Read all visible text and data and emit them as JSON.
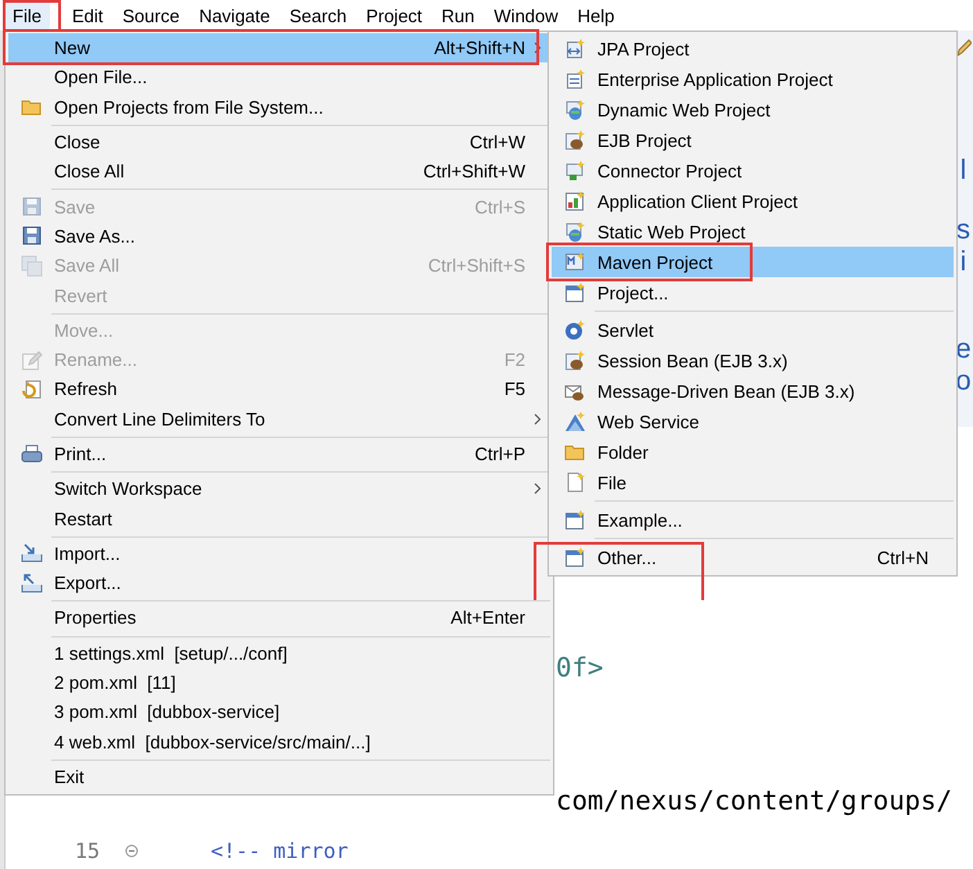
{
  "menu_bar": [
    {
      "label": "File",
      "selected": true
    },
    {
      "label": "Edit",
      "selected": false
    },
    {
      "label": "Source",
      "selected": false
    },
    {
      "label": "Navigate",
      "selected": false
    },
    {
      "label": "Search",
      "selected": false
    },
    {
      "label": "Project",
      "selected": false
    },
    {
      "label": "Run",
      "selected": false
    },
    {
      "label": "Window",
      "selected": false
    },
    {
      "label": "Help",
      "selected": false
    }
  ],
  "file_menu": {
    "sections": [
      {
        "items": [
          {
            "label": "New",
            "shortcut": "Alt+Shift+N",
            "submenu": true,
            "selected": true,
            "disabled": false
          },
          {
            "label": "Open File...",
            "submenu": false,
            "selected": false,
            "disabled": false
          },
          {
            "label": "Open Projects from File System...",
            "submenu": false,
            "selected": false,
            "disabled": false
          }
        ]
      },
      {
        "items": [
          {
            "label": "Close",
            "shortcut": "Ctrl+W",
            "submenu": false,
            "selected": false,
            "disabled": false
          },
          {
            "label": "Close All",
            "shortcut": "Ctrl+Shift+W",
            "submenu": false,
            "selected": false,
            "disabled": false
          }
        ]
      },
      {
        "items": [
          {
            "label": "Save",
            "shortcut": "Ctrl+S",
            "submenu": false,
            "selected": false,
            "disabled": true
          },
          {
            "label": "Save As...",
            "submenu": false,
            "selected": false,
            "disabled": false
          },
          {
            "label": "Save All",
            "shortcut": "Ctrl+Shift+S",
            "submenu": false,
            "selected": false,
            "disabled": true
          },
          {
            "label": "Revert",
            "submenu": false,
            "selected": false,
            "disabled": true
          }
        ]
      },
      {
        "items": [
          {
            "label": "Move...",
            "submenu": false,
            "selected": false,
            "disabled": true
          },
          {
            "label": "Rename...",
            "shortcut": "F2",
            "submenu": false,
            "selected": false,
            "disabled": true
          },
          {
            "label": "Refresh",
            "shortcut": "F5",
            "submenu": false,
            "selected": false,
            "disabled": false
          },
          {
            "label": "Convert Line Delimiters To",
            "submenu": true,
            "selected": false,
            "disabled": false
          }
        ]
      },
      {
        "items": [
          {
            "label": "Print...",
            "shortcut": "Ctrl+P",
            "submenu": false,
            "selected": false,
            "disabled": false
          }
        ]
      },
      {
        "items": [
          {
            "label": "Switch Workspace",
            "submenu": true,
            "selected": false,
            "disabled": false
          },
          {
            "label": "Restart",
            "submenu": false,
            "selected": false,
            "disabled": false
          }
        ]
      },
      {
        "items": [
          {
            "label": "Import...",
            "submenu": false,
            "selected": false,
            "disabled": false
          },
          {
            "label": "Export...",
            "submenu": false,
            "selected": false,
            "disabled": false
          }
        ]
      },
      {
        "items": [
          {
            "label": "Properties",
            "shortcut": "Alt+Enter",
            "submenu": false,
            "selected": false,
            "disabled": false
          }
        ]
      },
      {
        "items": [
          {
            "label": "1 settings.xml  [setup/.../conf]",
            "submenu": false,
            "selected": false,
            "disabled": false
          },
          {
            "label": "2 pom.xml  [11]",
            "submenu": false,
            "selected": false,
            "disabled": false
          },
          {
            "label": "3 pom.xml  [dubbox-service]",
            "submenu": false,
            "selected": false,
            "disabled": false
          },
          {
            "label": "4 web.xml  [dubbox-service/src/main/...]",
            "submenu": false,
            "selected": false,
            "disabled": false
          }
        ]
      },
      {
        "items": [
          {
            "label": "Exit",
            "submenu": false,
            "selected": false,
            "disabled": false
          }
        ]
      }
    ]
  },
  "new_submenu": {
    "sections": [
      {
        "items": [
          {
            "label": "JPA Project",
            "selected": false
          },
          {
            "label": "Enterprise Application Project",
            "selected": false
          },
          {
            "label": "Dynamic Web Project",
            "selected": false
          },
          {
            "label": "EJB Project",
            "selected": false
          },
          {
            "label": "Connector Project",
            "selected": false
          },
          {
            "label": "Application Client Project",
            "selected": false
          },
          {
            "label": "Static Web Project",
            "selected": false
          },
          {
            "label": "Maven Project",
            "selected": true
          },
          {
            "label": "Project...",
            "selected": false
          }
        ]
      },
      {
        "items": [
          {
            "label": "Servlet",
            "selected": false
          },
          {
            "label": "Session Bean (EJB 3.x)",
            "selected": false
          },
          {
            "label": "Message-Driven Bean (EJB 3.x)",
            "selected": false
          },
          {
            "label": "Web Service",
            "selected": false
          },
          {
            "label": "Folder",
            "selected": false
          },
          {
            "label": "File",
            "selected": false
          }
        ]
      },
      {
        "items": [
          {
            "label": "Example...",
            "selected": false
          }
        ]
      },
      {
        "items": [
          {
            "label": "Other...",
            "shortcut": "Ctrl+N",
            "selected": false
          }
        ]
      }
    ]
  },
  "side_panel": {
    "letters": [
      "l",
      "s",
      "i",
      "e",
      "o"
    ]
  },
  "editor": {
    "lines": [
      {
        "text": "0f>",
        "kind": "attribute"
      },
      {
        "text": "com/nexus/content/groups/",
        "kind": "text"
      },
      {
        "line_number": "15",
        "text": "<!-- mirror",
        "kind": "comment"
      }
    ]
  }
}
